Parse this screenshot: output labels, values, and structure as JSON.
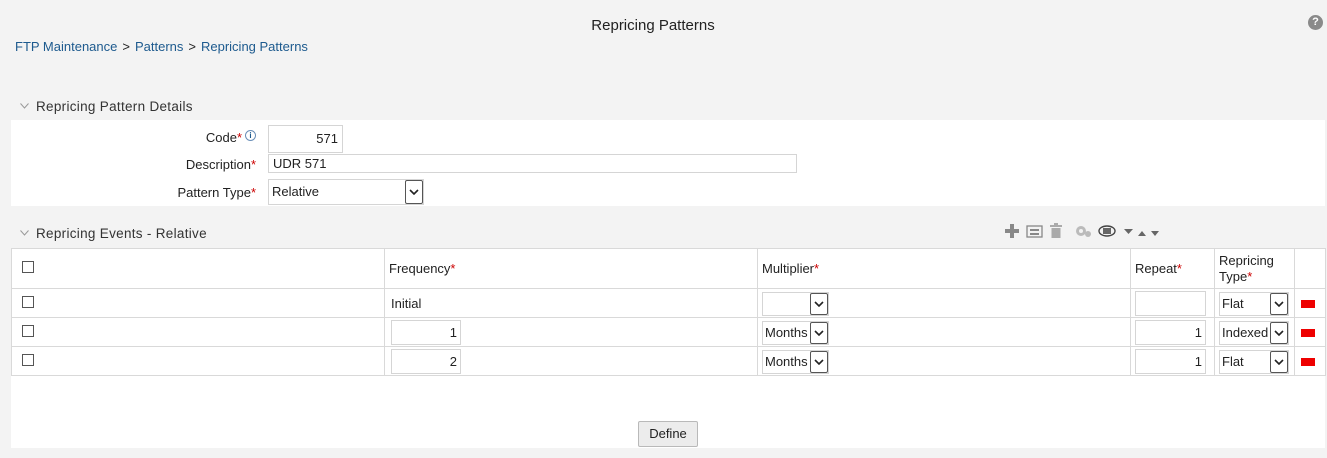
{
  "page": {
    "title": "Repricing Patterns",
    "help_icon": "?"
  },
  "breadcrumb": {
    "items": [
      "FTP Maintenance",
      "Patterns",
      "Repricing Patterns"
    ],
    "separator": ">"
  },
  "details": {
    "section_title": "Repricing Pattern Details",
    "code_label": "Code",
    "code_value": "571",
    "description_label": "Description",
    "description_value": "UDR 571",
    "pattern_type_label": "Pattern Type",
    "pattern_type_value": "Relative",
    "required_mark": "*",
    "info_icon": "i"
  },
  "events": {
    "section_title": "Repricing Events - Relative",
    "columns": {
      "frequency": "Frequency",
      "multiplier": "Multiplier",
      "repeat": "Repeat",
      "repricing_type_line1": "Repricing",
      "repricing_type_line2": "Type"
    },
    "rows": [
      {
        "frequency": "Initial",
        "multiplier": "",
        "repeat": "",
        "repricing_type": "Flat"
      },
      {
        "frequency": "1",
        "multiplier": "Months",
        "repeat": "1",
        "repricing_type": "Indexed"
      },
      {
        "frequency": "2",
        "multiplier": "Months",
        "repeat": "1",
        "repricing_type": "Flat"
      }
    ],
    "toolbar_icons": [
      "add-icon",
      "copy-icon",
      "delete-icon",
      "settings-icon",
      "view-icon",
      "sort-icon"
    ]
  },
  "actions": {
    "define_label": "Define"
  },
  "colors": {
    "link": "#1d5a8e",
    "required": "#cc0000",
    "delete_marker": "#ee0000"
  }
}
